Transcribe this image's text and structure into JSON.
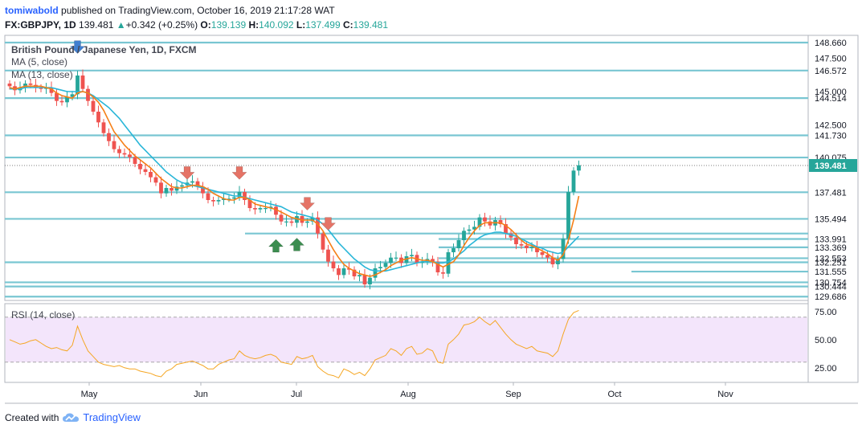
{
  "header": {
    "author": "tomiwabold",
    "published": "published on TradingView.com, October 16, 2019 21:17:28 WAT",
    "symbol": "FX:GBPJPY, 1D",
    "last": "139.481",
    "change": "+0.342 (+0.25%)",
    "o_label": "O:",
    "o_value": "139.139",
    "h_label": "H:",
    "h_value": "140.092",
    "l_label": "L:",
    "l_value": "137.499",
    "c_label": "C:",
    "c_value": "139.481"
  },
  "footer": {
    "created_with": "Created with",
    "brand": "TradingView"
  },
  "colors": {
    "level_line": "#79c6d2",
    "up_candle": "#26a69a",
    "down_candle": "#ef5350",
    "ma5": "#f57f17",
    "ma13": "#29b6d8",
    "rsi_line": "#f5a623",
    "rsi_band": "#f3e5fb",
    "price_tag": "#26a69a",
    "arrow_down": "#e57366",
    "arrow_up": "#3c8d50",
    "arrow_down_blue": "#3f7fd0"
  },
  "chart_data": [
    {
      "type": "candlestick",
      "title": "British Pound / Japanese Yen, 1D, FXCM",
      "indicators": [
        "MA (5, close)",
        "MA (13, close)"
      ],
      "price_axis_ticks": [
        "148.660",
        "147.500",
        "146.572",
        "145.000",
        "144.514",
        "142.500",
        "141.730",
        "140.075",
        "137.481",
        "135.494",
        "133.991",
        "133.369",
        "132.553",
        "132.251",
        "131.555",
        "130.754",
        "130.444",
        "129.686"
      ],
      "ylim": [
        129.4,
        149.2
      ],
      "last_price": 139.481,
      "x_tick_labels": [
        "May",
        "Jun",
        "Jul",
        "Aug",
        "Sep",
        "Oct",
        "Nov"
      ],
      "horizontal_levels": [
        148.66,
        146.572,
        144.514,
        141.73,
        140.075,
        137.481,
        135.494,
        134.4,
        133.991,
        133.369,
        132.553,
        132.251,
        131.555,
        130.754,
        130.444,
        129.686
      ],
      "close_series": [
        145.4,
        145.1,
        145.3,
        145.6,
        145.5,
        145.3,
        145.2,
        145.3,
        144.9,
        144.3,
        144.2,
        144.6,
        144.8,
        146.2,
        145.2,
        144.3,
        143.5,
        142.7,
        141.9,
        141.3,
        140.7,
        140.4,
        140.3,
        140.1,
        139.6,
        139.2,
        139.0,
        138.6,
        138.2,
        137.4,
        137.8,
        137.6,
        137.9,
        138.0,
        138.2,
        138.3,
        137.9,
        137.4,
        136.9,
        136.8,
        136.9,
        137.0,
        137.0,
        137.1,
        137.5,
        136.9,
        136.3,
        136.2,
        136.3,
        136.3,
        136.4,
        135.8,
        135.3,
        135.3,
        135.2,
        135.7,
        135.2,
        135.3,
        135.6,
        134.4,
        133.2,
        132.3,
        131.8,
        131.3,
        131.8,
        131.7,
        131.2,
        131.3,
        130.6,
        131.1,
        131.8,
        131.9,
        132.2,
        132.6,
        132.6,
        132.2,
        132.7,
        132.8,
        132.2,
        132.3,
        132.5,
        132.3,
        131.5,
        131.4,
        133.0,
        133.3,
        133.9,
        134.6,
        134.7,
        134.9,
        135.6,
        135.3,
        135.0,
        135.4,
        135.1,
        134.4,
        134.1,
        133.6,
        133.5,
        133.3,
        133.4,
        133.0,
        132.8,
        132.6,
        132.1,
        132.5,
        134.0,
        137.5,
        139.1,
        139.5
      ],
      "ma5_series": [
        145.3,
        145.2,
        145.3,
        145.4,
        145.4,
        145.4,
        145.4,
        145.3,
        145.2,
        144.9,
        144.7,
        144.6,
        144.5,
        144.9,
        145.0,
        144.9,
        144.6,
        144.2,
        143.6,
        142.8,
        142.0,
        141.5,
        141.0,
        140.6,
        140.2,
        139.9,
        139.6,
        139.3,
        138.9,
        138.5,
        138.2,
        137.9,
        137.8,
        137.8,
        137.9,
        138.0,
        138.0,
        137.9,
        137.7,
        137.4,
        137.2,
        137.0,
        136.9,
        136.9,
        137.1,
        137.1,
        136.9,
        136.6,
        136.5,
        136.4,
        136.3,
        136.2,
        136.0,
        135.8,
        135.6,
        135.5,
        135.4,
        135.4,
        135.4,
        135.1,
        134.6,
        133.9,
        133.2,
        132.6,
        132.1,
        131.8,
        131.6,
        131.4,
        131.3,
        131.2,
        131.3,
        131.5,
        131.7,
        132.0,
        132.2,
        132.4,
        132.5,
        132.6,
        132.5,
        132.4,
        132.4,
        132.3,
        132.1,
        131.9,
        132.1,
        132.3,
        132.8,
        133.5,
        134.1,
        134.6,
        135.0,
        135.2,
        135.2,
        135.2,
        135.2,
        135.0,
        134.7,
        134.3,
        133.9,
        133.6,
        133.5,
        133.3,
        133.1,
        132.9,
        132.6,
        132.4,
        132.8,
        133.9,
        135.4,
        137.2
      ],
      "ma13_series": [
        145.2,
        145.2,
        145.2,
        145.3,
        145.3,
        145.3,
        145.3,
        145.3,
        145.3,
        145.2,
        145.1,
        145.0,
        145.0,
        145.0,
        145.0,
        144.9,
        144.7,
        144.4,
        144.1,
        143.8,
        143.4,
        143.0,
        142.5,
        142.0,
        141.5,
        141.0,
        140.6,
        140.2,
        139.8,
        139.4,
        139.0,
        138.7,
        138.4,
        138.2,
        138.1,
        138.0,
        137.9,
        137.8,
        137.7,
        137.6,
        137.5,
        137.4,
        137.3,
        137.2,
        137.2,
        137.1,
        137.0,
        136.9,
        136.8,
        136.7,
        136.6,
        136.5,
        136.4,
        136.2,
        136.0,
        135.9,
        135.8,
        135.7,
        135.6,
        135.4,
        135.1,
        134.7,
        134.2,
        133.7,
        133.3,
        132.9,
        132.5,
        132.2,
        131.9,
        131.7,
        131.6,
        131.6,
        131.6,
        131.7,
        131.8,
        131.9,
        132.0,
        132.1,
        132.2,
        132.3,
        132.3,
        132.3,
        132.2,
        132.2,
        132.3,
        132.5,
        132.8,
        133.1,
        133.5,
        133.8,
        134.1,
        134.3,
        134.4,
        134.5,
        134.5,
        134.4,
        134.3,
        134.2,
        134.0,
        133.8,
        133.6,
        133.4,
        133.3,
        133.1,
        133.0,
        132.9,
        133.0,
        133.4,
        133.8,
        134.2
      ],
      "arrows": [
        {
          "dir": "down",
          "color": "blue",
          "index": 13,
          "price": 148.8
        },
        {
          "dir": "down",
          "color": "red",
          "index": 34,
          "price": 139.4
        },
        {
          "dir": "down",
          "color": "red",
          "index": 44,
          "price": 139.4
        },
        {
          "dir": "down",
          "color": "red",
          "index": 57,
          "price": 137.1
        },
        {
          "dir": "down",
          "color": "red",
          "index": 61,
          "price": 135.6
        },
        {
          "dir": "up",
          "color": "green",
          "index": 51,
          "price": 133.0
        },
        {
          "dir": "up",
          "color": "green",
          "index": 55,
          "price": 133.1
        }
      ]
    },
    {
      "type": "line",
      "title": "RSI (14, close)",
      "y_ticks": [
        "75.00",
        "50.00",
        "25.00"
      ],
      "ylim": [
        12,
        82
      ],
      "band": [
        30,
        70
      ],
      "values": [
        50,
        48,
        46,
        47,
        49,
        50,
        47,
        44,
        42,
        43,
        41,
        40,
        45,
        62,
        50,
        40,
        35,
        30,
        28,
        27,
        26,
        27,
        25,
        24,
        24,
        22,
        21,
        20,
        18,
        17,
        22,
        24,
        28,
        29,
        30,
        31,
        29,
        27,
        24,
        24,
        28,
        30,
        32,
        33,
        40,
        36,
        34,
        33,
        34,
        36,
        37,
        35,
        30,
        29,
        28,
        35,
        33,
        34,
        36,
        26,
        22,
        19,
        18,
        16,
        24,
        22,
        19,
        21,
        18,
        24,
        32,
        34,
        36,
        42,
        40,
        36,
        42,
        44,
        37,
        38,
        42,
        40,
        30,
        29,
        46,
        50,
        55,
        63,
        64,
        66,
        70,
        66,
        63,
        67,
        61,
        55,
        50,
        46,
        44,
        42,
        44,
        40,
        39,
        38,
        35,
        40,
        55,
        68,
        74,
        76
      ]
    }
  ]
}
